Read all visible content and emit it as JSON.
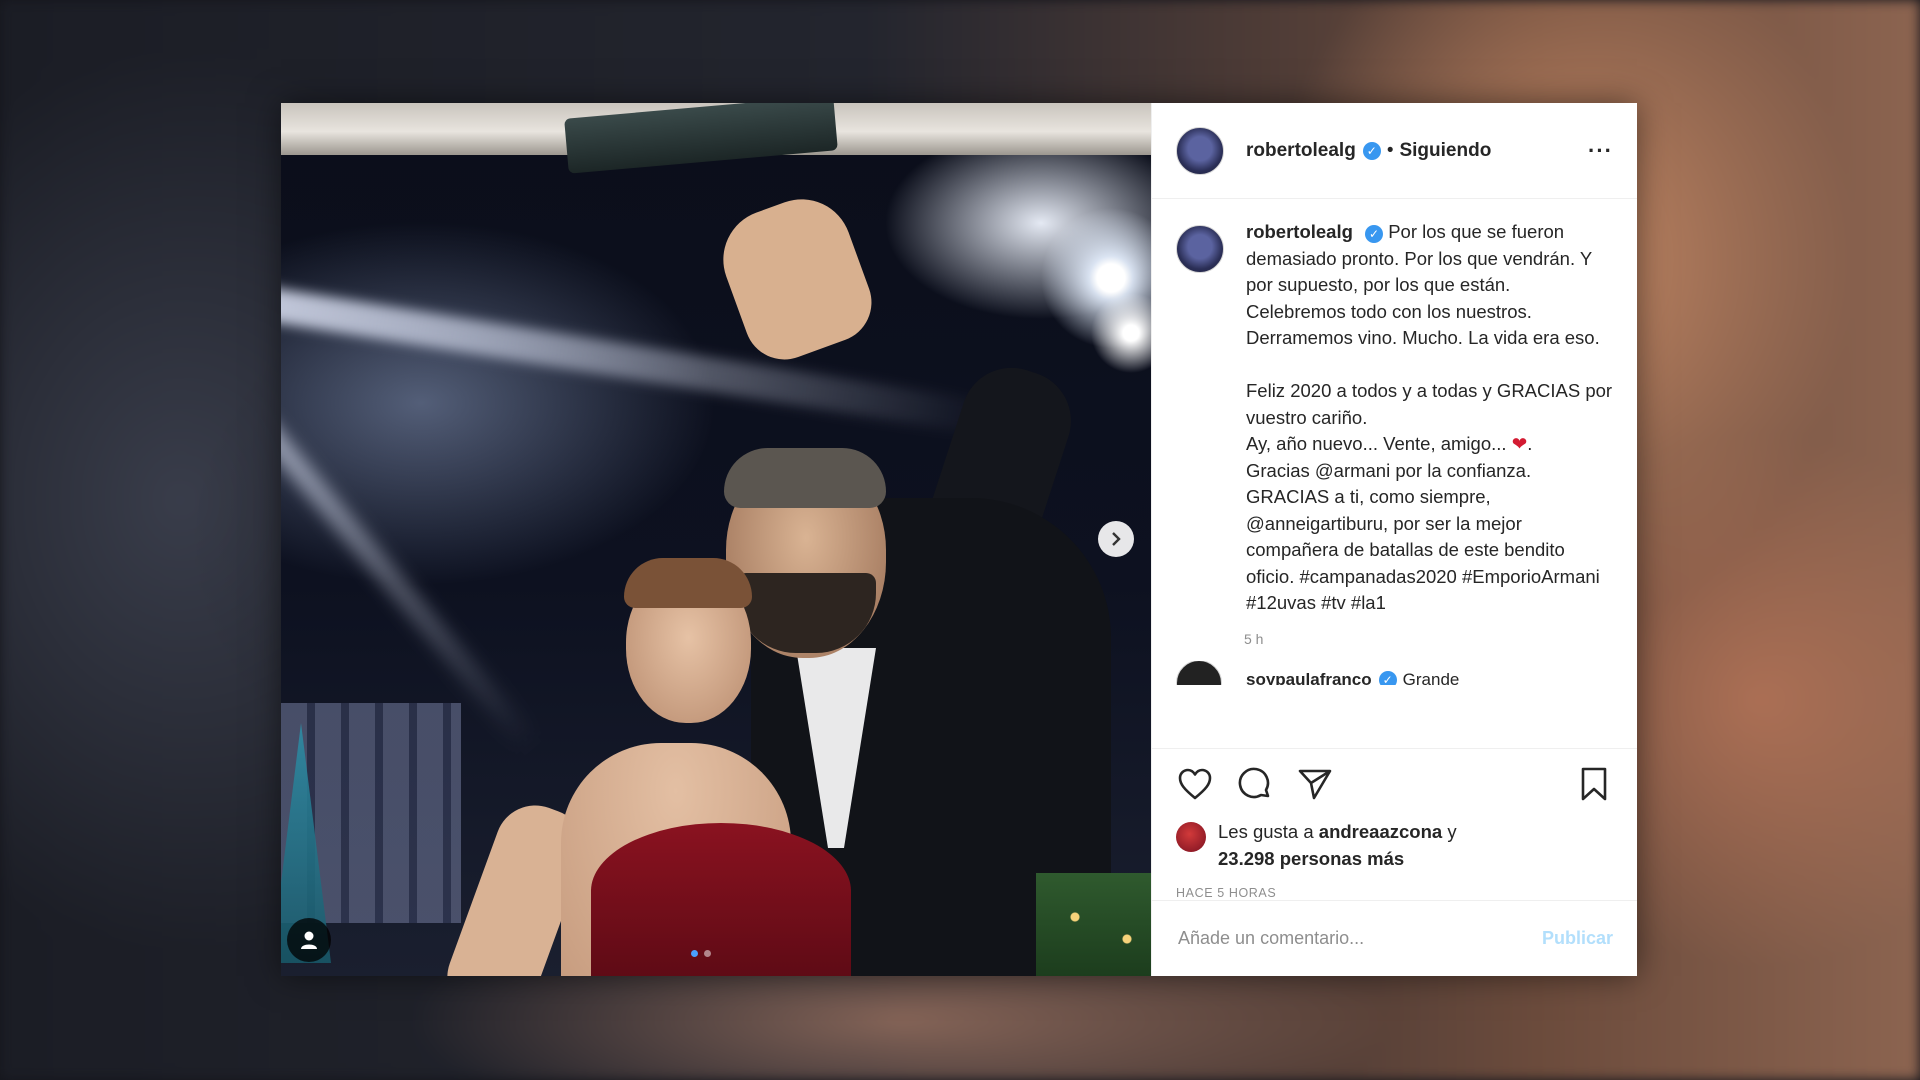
{
  "header": {
    "username": "robertolealg",
    "separator": "•",
    "follow_status": "Siguiendo",
    "more_glyph": "···"
  },
  "caption": {
    "username": "robertolealg",
    "text_before_heart": "Por los que se fueron demasiado pronto. Por los que vendrán. Y por supuesto, por los que están. Celebremos todo con los nuestros. Derramemos vino. Mucho. La vida era eso.\n\nFeliz 2020 a todos y a todas y GRACIAS por vuestro cariño.\nAy, año nuevo... Vente, amigo... ",
    "heart": "❤",
    "text_after_heart": ".\nGracias @armani por la confianza.\nGRACIAS a ti, como siempre, @anneigartiburu, por ser la mejor compañera de batallas de este bendito oficio. #campanadas2020 #EmporioArmani #12uvas #tv #la1",
    "time": "5 h"
  },
  "next_comment": {
    "username": "soypaulafranco",
    "text": "Grande"
  },
  "actions": {
    "like_icon": "heart-outline-icon",
    "comment_icon": "comment-bubble-icon",
    "share_icon": "paper-plane-icon",
    "save_icon": "bookmark-icon"
  },
  "likes": {
    "prefix": "Les gusta a ",
    "user": "andreaazcona",
    "connector": " y",
    "count": "23.298 personas más"
  },
  "posted_ago": "HACE 5 HORAS",
  "comment_box": {
    "placeholder": "Añade un comentario...",
    "publish_label": "Publicar"
  },
  "colors": {
    "verified": "#3897f0",
    "publish_disabled": "#b2dffc",
    "heart": "#d31b32"
  }
}
